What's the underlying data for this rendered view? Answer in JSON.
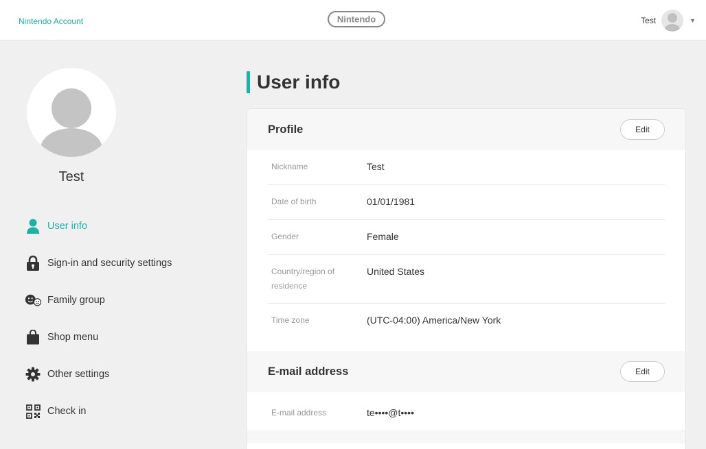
{
  "header": {
    "account_link": "Nintendo Account",
    "logo_text": "Nintendo",
    "user_name": "Test",
    "caret": "▼"
  },
  "sidebar": {
    "profile_name": "Test",
    "items": [
      {
        "label": "User info",
        "icon": "person-icon",
        "active": true
      },
      {
        "label": "Sign-in and security settings",
        "icon": "lock-icon"
      },
      {
        "label": "Family group",
        "icon": "family-icon"
      },
      {
        "label": "Shop menu",
        "icon": "shopping-bag-icon"
      },
      {
        "label": "Other settings",
        "icon": "gear-icon"
      },
      {
        "label": "Check in",
        "icon": "qr-code-icon"
      }
    ]
  },
  "main": {
    "page_title": "User info",
    "profile": {
      "title": "Profile",
      "edit_label": "Edit",
      "rows": [
        {
          "label": "Nickname",
          "value": "Test"
        },
        {
          "label": "Date of birth",
          "value": "01/01/1981"
        },
        {
          "label": "Gender",
          "value": "Female"
        },
        {
          "label": "Country/region of residence",
          "value": "United States"
        },
        {
          "label": "Time zone",
          "value": "(UTC-04:00) America/New York"
        }
      ]
    },
    "email": {
      "title": "E-mail address",
      "edit_label": "Edit",
      "rows": [
        {
          "label": "E-mail address",
          "value": "te••••@t••••"
        }
      ]
    }
  },
  "colors": {
    "accent": "#1ab3a6",
    "background": "#f0f0f0",
    "card": "#ffffff"
  }
}
